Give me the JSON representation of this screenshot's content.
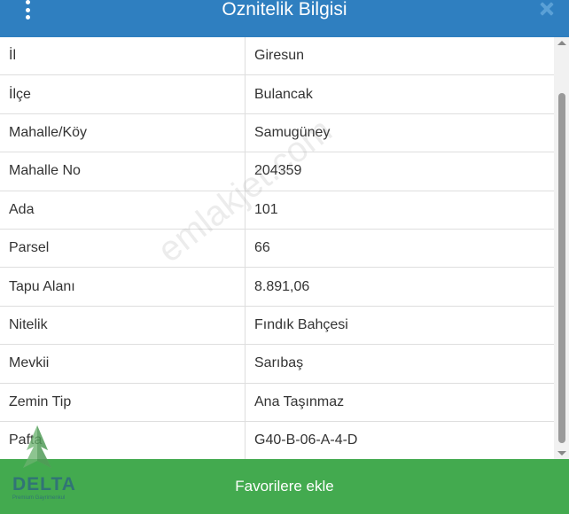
{
  "header": {
    "title": "Oznitelik Bilgisi"
  },
  "rows": [
    {
      "key": "İl",
      "value": "Giresun"
    },
    {
      "key": "İlçe",
      "value": "Bulancak"
    },
    {
      "key": "Mahalle/Köy",
      "value": "Samugüney"
    },
    {
      "key": "Mahalle No",
      "value": "204359"
    },
    {
      "key": "Ada",
      "value": "101"
    },
    {
      "key": "Parsel",
      "value": "66"
    },
    {
      "key": "Tapu Alanı",
      "value": "8.891,06"
    },
    {
      "key": "Nitelik",
      "value": "Fındık Bahçesi"
    },
    {
      "key": "Mevkii",
      "value": "Sarıbaş"
    },
    {
      "key": "Zemin Tip",
      "value": "Ana Taşınmaz"
    },
    {
      "key": "Pafta",
      "value": "G40-B-06-A-4-D"
    }
  ],
  "footer": {
    "button_label": "Favorilere ekle"
  },
  "watermark": "emlakjet.com",
  "logo": {
    "text": "DELTA",
    "subtext": "Premium Gayrimenkul"
  },
  "colors": {
    "header": "#2f7fc0",
    "footer": "#43aa4f"
  }
}
